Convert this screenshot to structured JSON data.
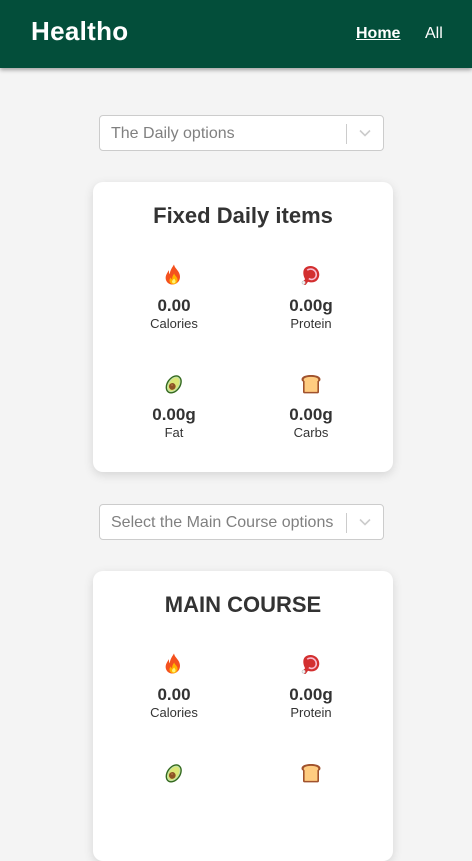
{
  "navbar": {
    "brand": "Healtho",
    "links": [
      {
        "label": "Home",
        "active": true
      },
      {
        "label": "All",
        "active": false
      }
    ],
    "color": "#034e3a"
  },
  "sections": [
    {
      "select_placeholder": "The Daily options",
      "card_title": "Fixed Daily items",
      "stats": [
        {
          "icon": "fire-icon",
          "value": "0.00",
          "label": "Calories"
        },
        {
          "icon": "meat-icon",
          "value": "0.00g",
          "label": "Protein"
        },
        {
          "icon": "avocado-icon",
          "value": "0.00g",
          "label": "Fat"
        },
        {
          "icon": "bread-icon",
          "value": "0.00g",
          "label": "Carbs"
        }
      ]
    },
    {
      "select_placeholder": "Select the Main Course options",
      "card_title": "MAIN COURSE",
      "stats": [
        {
          "icon": "fire-icon",
          "value": "0.00",
          "label": "Calories"
        },
        {
          "icon": "meat-icon",
          "value": "0.00g",
          "label": "Protein"
        },
        {
          "icon": "avocado-icon",
          "value": "",
          "label": ""
        },
        {
          "icon": "bread-icon",
          "value": "",
          "label": ""
        }
      ]
    }
  ]
}
